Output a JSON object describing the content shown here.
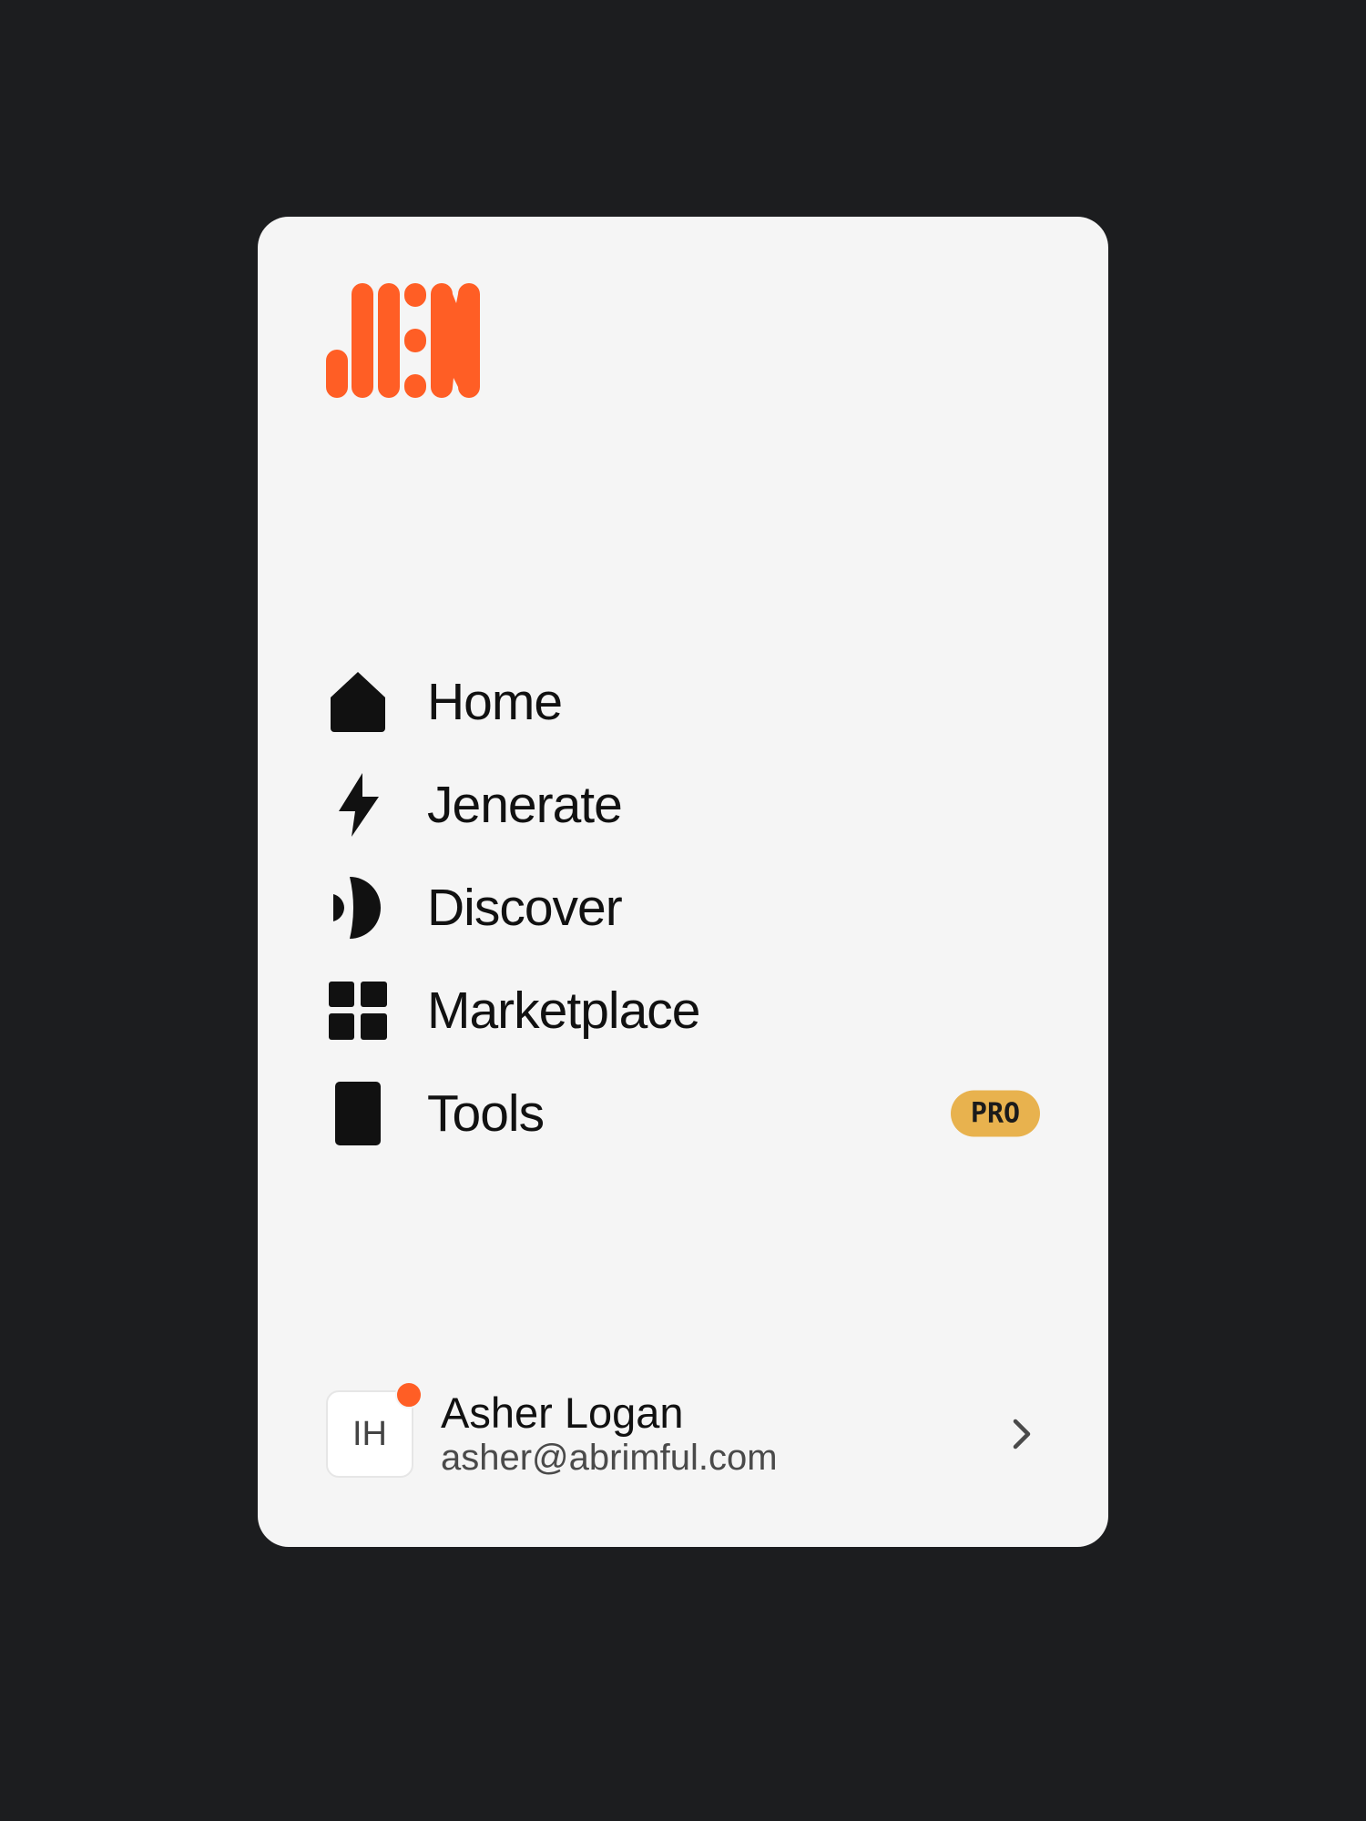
{
  "brand": {
    "logo_text": "JEN",
    "accent_color": "#ff5e25"
  },
  "nav": {
    "items": [
      {
        "label": "Home",
        "icon": "home-icon"
      },
      {
        "label": "Jenerate",
        "icon": "lightning-icon"
      },
      {
        "label": "Discover",
        "icon": "discover-icon"
      },
      {
        "label": "Marketplace",
        "icon": "grid-icon"
      },
      {
        "label": "Tools",
        "icon": "tools-icon",
        "badge": "PRO"
      }
    ],
    "badge_color": "#e8b24e"
  },
  "user": {
    "initials": "IH",
    "name": "Asher Logan",
    "email": "asher@abrimful.com",
    "notification_color": "#ff5e25"
  },
  "colors": {
    "background": "#1c1d1f",
    "card": "#f5f5f5",
    "text": "#111111"
  }
}
